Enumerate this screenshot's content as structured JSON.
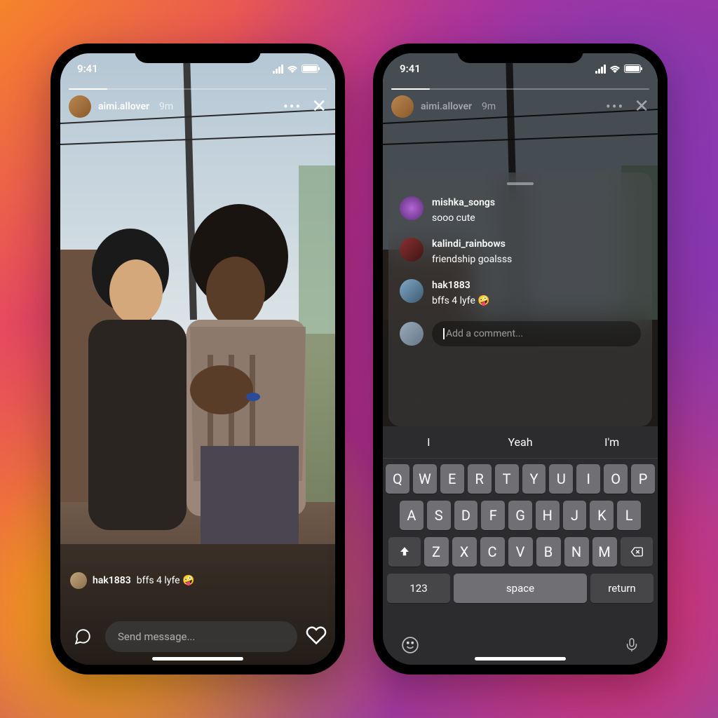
{
  "status": {
    "time": "9:41"
  },
  "story": {
    "username": "aimi.allover",
    "timestamp": "9m",
    "send_placeholder": "Send message...",
    "comment_chip": {
      "username": "hak1883",
      "text": "bffs 4 lyfe 🤪"
    }
  },
  "comments": {
    "placeholder": "Add a comment...",
    "list": [
      {
        "username": "mishka_songs",
        "text": "sooo cute"
      },
      {
        "username": "kalindi_rainbows",
        "text": "friendship goalsss"
      },
      {
        "username": "hak1883",
        "text": "bffs 4 lyfe 🤪"
      }
    ]
  },
  "keyboard": {
    "predictions": [
      "I",
      "Yeah",
      "I'm"
    ],
    "row1": [
      "Q",
      "W",
      "E",
      "R",
      "T",
      "Y",
      "U",
      "I",
      "O",
      "P"
    ],
    "row2": [
      "A",
      "S",
      "D",
      "F",
      "G",
      "H",
      "J",
      "K",
      "L"
    ],
    "row3": [
      "Z",
      "X",
      "C",
      "V",
      "B",
      "N",
      "M"
    ],
    "numkey": "123",
    "space": "space",
    "return": "return"
  }
}
